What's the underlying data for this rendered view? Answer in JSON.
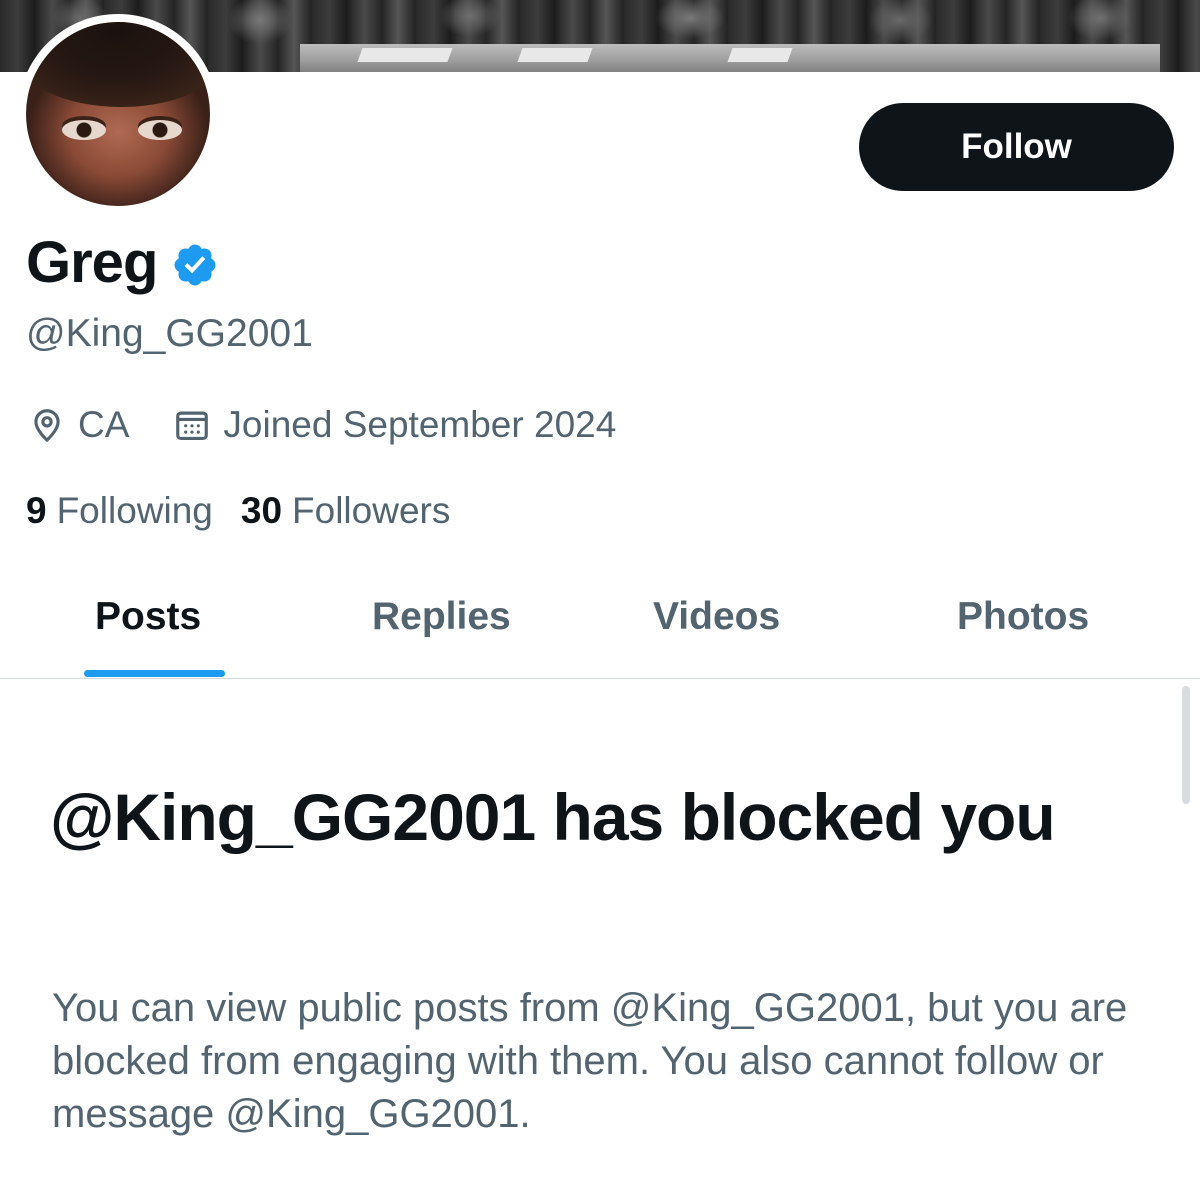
{
  "profile": {
    "display_name": "Greg",
    "verified_icon": "verified-badge-icon",
    "handle": "@King_GG2001",
    "location": "CA",
    "joined": "Joined September 2024",
    "following_count": "9",
    "following_label": "Following",
    "followers_count": "30",
    "followers_label": "Followers"
  },
  "actions": {
    "follow_label": "Follow"
  },
  "tabs": [
    {
      "label": "Posts",
      "active": true
    },
    {
      "label": "Replies",
      "active": false
    },
    {
      "label": "Videos",
      "active": false
    },
    {
      "label": "Photos",
      "active": false
    }
  ],
  "blocked": {
    "title": "@King_GG2001 has blocked you",
    "description": "You can view public posts from @King_GG2001, but you are blocked from engaging with them. You also cannot follow or message @King_GG2001."
  },
  "colors": {
    "accent": "#1d9bf0",
    "text_primary": "#0f1419",
    "text_secondary": "#536471",
    "button_bg": "#0f1419"
  }
}
